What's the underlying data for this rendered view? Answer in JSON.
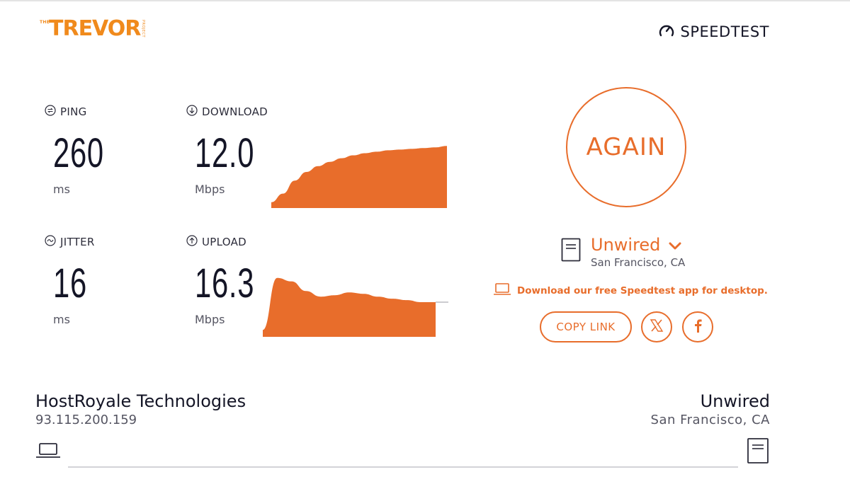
{
  "header": {
    "logo_small": "THE",
    "logo_main": "TREVOR",
    "logo_side": "PROJECT",
    "brand": "SPEEDTEST",
    "brand_icon": "gauge-icon"
  },
  "metrics": {
    "ping": {
      "label": "PING",
      "value": "260",
      "unit": "ms",
      "icon": "ping-icon"
    },
    "jitter": {
      "label": "JITTER",
      "value": "16",
      "unit": "ms",
      "icon": "jitter-icon"
    },
    "download": {
      "label": "DOWNLOAD",
      "value": "12.0",
      "unit": "Mbps",
      "icon": "download-arrow-icon"
    },
    "upload": {
      "label": "UPLOAD",
      "value": "16.3",
      "unit": "Mbps",
      "icon": "upload-arrow-icon"
    }
  },
  "chart_data": [
    {
      "type": "area",
      "name": "download",
      "values": [
        0.08,
        0.2,
        0.38,
        0.5,
        0.58,
        0.64,
        0.69,
        0.73,
        0.76,
        0.78,
        0.8,
        0.81,
        0.82,
        0.83,
        0.84,
        0.86
      ]
    },
    {
      "type": "area",
      "name": "upload",
      "values": [
        0.1,
        0.85,
        0.8,
        0.66,
        0.58,
        0.6,
        0.64,
        0.62,
        0.58,
        0.55,
        0.53,
        0.5,
        0.5
      ]
    }
  ],
  "actions": {
    "again_label": "AGAIN",
    "download_app_text": "Download our free Speedtest app for desktop.",
    "copy_link_label": "COPY LINK"
  },
  "server": {
    "name": "Unwired",
    "location": "San Francisco, CA"
  },
  "connection": {
    "isp_name": "HostRoyale Technologies",
    "ip": "93.115.200.159",
    "host_name": "Unwired",
    "host_location": "San Francisco, CA"
  },
  "colors": {
    "accent": "#e86d2b",
    "logo": "#f08a1c",
    "text_dark": "#141526",
    "text_muted": "#555562"
  }
}
